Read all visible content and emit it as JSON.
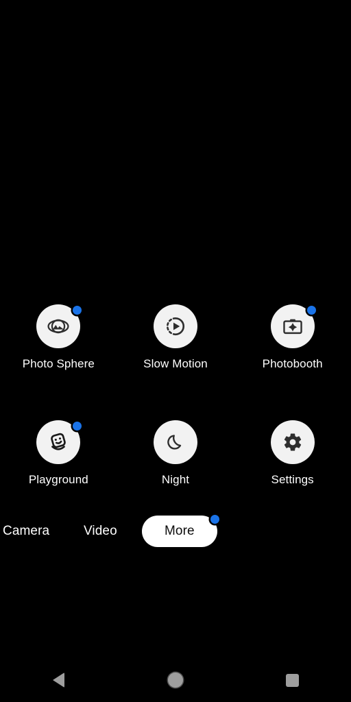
{
  "app": {
    "name": "Camera",
    "screen": "more-modes",
    "background_color": "#000000"
  },
  "colors": {
    "badge_blue": "#1a73e8",
    "circle_white": "#f2f2f2",
    "label_white": "#ffffff",
    "pill_white": "#ffffff",
    "pill_text": "#0d0d0d",
    "nav_icon_gray": "#9e9e9e"
  },
  "modes": [
    {
      "label": "Photo Sphere",
      "icon": "photo-sphere-icon",
      "badge": true
    },
    {
      "label": "Slow Motion",
      "icon": "slow-motion-icon",
      "badge": false
    },
    {
      "label": "Photobooth",
      "icon": "photobooth-icon",
      "badge": true
    },
    {
      "label": "Playground",
      "icon": "playground-icon",
      "badge": true
    },
    {
      "label": "Night",
      "icon": "night-moon-icon",
      "badge": false
    },
    {
      "label": "Settings",
      "icon": "gear-icon",
      "badge": false
    }
  ],
  "mode_strip": {
    "items": [
      {
        "label": "Camera",
        "selected": false
      },
      {
        "label": "Video",
        "selected": false
      },
      {
        "label": "More",
        "selected": true,
        "badge": true
      }
    ]
  },
  "navbar": {
    "back": "back-icon",
    "home": "home-icon",
    "recents": "recents-icon"
  }
}
